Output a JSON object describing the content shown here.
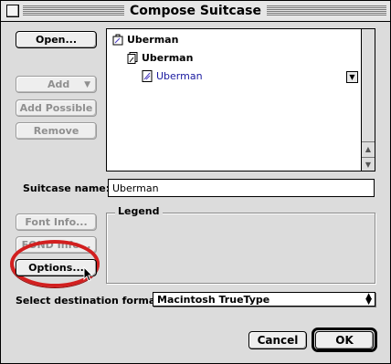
{
  "window": {
    "title": "Compose Suitcase"
  },
  "buttons": {
    "open": "Open...",
    "add": "Add",
    "add_possible": "Add Possible",
    "remove": "Remove",
    "font_info": "Font Info...",
    "fond_info": "FOND Info...",
    "options": "Options...",
    "cancel": "Cancel",
    "ok": "OK"
  },
  "suitcase_tree": [
    {
      "label": "Uberman",
      "level": 0,
      "icon": "suitcase-icon"
    },
    {
      "label": "Uberman",
      "level": 1,
      "icon": "font-family-icon"
    },
    {
      "label": "Uberman",
      "level": 2,
      "icon": "font-file-icon"
    }
  ],
  "suitcase_name": {
    "label": "Suitcase name:",
    "value": "Uberman"
  },
  "legend": {
    "title": "Legend"
  },
  "destination": {
    "label": "Select destination format:",
    "value": "Macintosh TrueType"
  },
  "colors": {
    "highlight": "#d21f1f",
    "selected_text": "#1a1aa0"
  }
}
